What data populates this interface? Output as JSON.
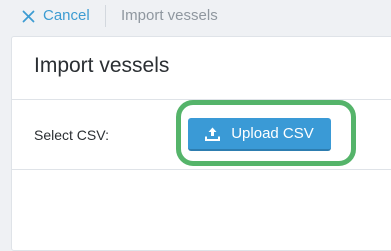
{
  "header": {
    "cancel_label": "Cancel",
    "breadcrumb_title": "Import vessels"
  },
  "panel": {
    "title": "Import vessels",
    "field_label": "Select CSV:",
    "upload_button_label": "Upload CSV"
  },
  "icons": {
    "cancel": "close-icon",
    "upload": "upload-icon"
  },
  "colors": {
    "accent": "#3a9ad6",
    "highlight": "#55b46a"
  }
}
